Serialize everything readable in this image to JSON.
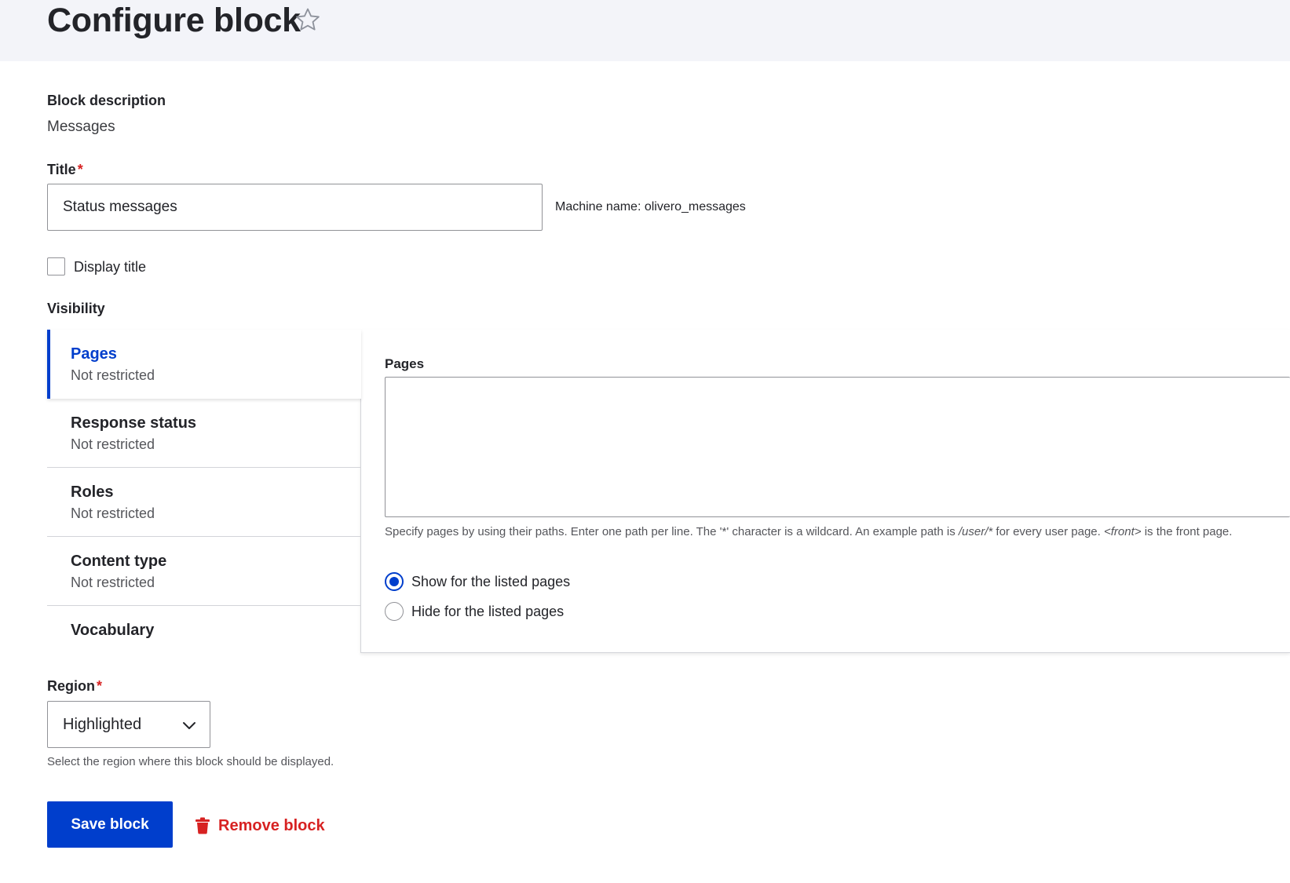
{
  "header": {
    "title": "Configure block",
    "star_icon": "star-outline-icon"
  },
  "block_description": {
    "label": "Block description",
    "value": "Messages"
  },
  "title_field": {
    "label": "Title",
    "required_marker": "*",
    "value": "Status messages",
    "machine_name": "Machine name: olivero_messages"
  },
  "display_title": {
    "label": "Display title",
    "checked": false
  },
  "visibility": {
    "label": "Visibility",
    "tabs": [
      {
        "title": "Pages",
        "summary": "Not restricted",
        "active": true
      },
      {
        "title": "Response status",
        "summary": "Not restricted"
      },
      {
        "title": "Roles",
        "summary": "Not restricted"
      },
      {
        "title": "Content type",
        "summary": "Not restricted"
      },
      {
        "title": "Vocabulary",
        "summary": ""
      }
    ],
    "pages_panel": {
      "label": "Pages",
      "textarea_value": "",
      "help_prefix": "Specify pages by using their paths. Enter one path per line. The '*' character is a wildcard. An example path is ",
      "help_example": "/user/*",
      "help_middle": " for every user page. ",
      "help_front": "<front>",
      "help_suffix": " is the front page.",
      "options": [
        {
          "label": "Show for the listed pages",
          "checked": true
        },
        {
          "label": "Hide for the listed pages",
          "checked": false
        }
      ]
    }
  },
  "region": {
    "label": "Region",
    "required_marker": "*",
    "selected": "Highlighted",
    "help": "Select the region where this block should be displayed."
  },
  "actions": {
    "save_label": "Save block",
    "remove_label": "Remove block"
  },
  "colors": {
    "accent": "#003ecc",
    "danger": "#d72222",
    "header_bg": "#f3f4f9"
  }
}
